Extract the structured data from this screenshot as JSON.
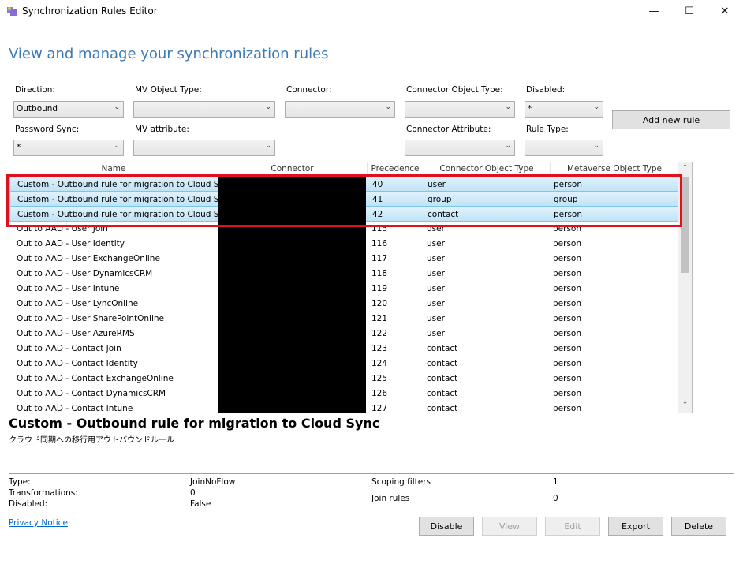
{
  "window": {
    "title": "Synchronization Rules Editor",
    "minimize": "—",
    "maximize": "☐",
    "close": "✕"
  },
  "heading": "View and manage your synchronization rules",
  "filters": {
    "direction": {
      "label": "Direction:",
      "value": "Outbound"
    },
    "mv_object_type": {
      "label": "MV Object Type:",
      "value": ""
    },
    "connector": {
      "label": "Connector:",
      "value": ""
    },
    "connector_object_type": {
      "label": "Connector Object Type:",
      "value": ""
    },
    "disabled": {
      "label": "Disabled:",
      "value": "*"
    },
    "password_sync": {
      "label": "Password Sync:",
      "value": "*"
    },
    "mv_attribute": {
      "label": "MV attribute:",
      "value": ""
    },
    "connector_attribute": {
      "label": "Connector Attribute:",
      "value": ""
    },
    "rule_type": {
      "label": "Rule Type:",
      "value": ""
    }
  },
  "add_rule_label": "Add new rule",
  "columns": [
    "Name",
    "Connector",
    "Precedence",
    "Connector Object Type",
    "Metaverse Object Type"
  ],
  "rows": [
    {
      "name": "Custom - Outbound rule for migration to Cloud Sync",
      "precedence": "40",
      "cot": "user",
      "mot": "person",
      "selected": true
    },
    {
      "name": "Custom - Outbound rule for migration to Cloud Sync",
      "precedence": "41",
      "cot": "group",
      "mot": "group",
      "selected": true
    },
    {
      "name": "Custom - Outbound rule for migration to Cloud Sync",
      "precedence": "42",
      "cot": "contact",
      "mot": "person",
      "selected": true
    },
    {
      "name": "Out to AAD - User Join",
      "precedence": "115",
      "cot": "user",
      "mot": "person",
      "selected": false
    },
    {
      "name": "Out to AAD - User Identity",
      "precedence": "116",
      "cot": "user",
      "mot": "person",
      "selected": false
    },
    {
      "name": "Out to AAD - User ExchangeOnline",
      "precedence": "117",
      "cot": "user",
      "mot": "person",
      "selected": false
    },
    {
      "name": "Out to AAD - User DynamicsCRM",
      "precedence": "118",
      "cot": "user",
      "mot": "person",
      "selected": false
    },
    {
      "name": "Out to AAD - User Intune",
      "precedence": "119",
      "cot": "user",
      "mot": "person",
      "selected": false
    },
    {
      "name": "Out to AAD - User LyncOnline",
      "precedence": "120",
      "cot": "user",
      "mot": "person",
      "selected": false
    },
    {
      "name": "Out to AAD - User SharePointOnline",
      "precedence": "121",
      "cot": "user",
      "mot": "person",
      "selected": false
    },
    {
      "name": "Out to AAD - User AzureRMS",
      "precedence": "122",
      "cot": "user",
      "mot": "person",
      "selected": false
    },
    {
      "name": "Out to AAD - Contact Join",
      "precedence": "123",
      "cot": "contact",
      "mot": "person",
      "selected": false
    },
    {
      "name": "Out to AAD - Contact Identity",
      "precedence": "124",
      "cot": "contact",
      "mot": "person",
      "selected": false
    },
    {
      "name": "Out to AAD - Contact ExchangeOnline",
      "precedence": "125",
      "cot": "contact",
      "mot": "person",
      "selected": false
    },
    {
      "name": "Out to AAD - Contact DynamicsCRM",
      "precedence": "126",
      "cot": "contact",
      "mot": "person",
      "selected": false
    },
    {
      "name": "Out to AAD - Contact Intune",
      "precedence": "127",
      "cot": "contact",
      "mot": "person",
      "selected": false
    }
  ],
  "detail": {
    "title": "Custom - Outbound rule for migration to Cloud Sync",
    "description": "クラウド同期への移行用アウトバウンドルール",
    "type_label": "Type:",
    "type_value": "JoinNoFlow",
    "transformations_label": "Transformations:",
    "transformations_value": "0",
    "disabled_label": "Disabled:",
    "disabled_value": "False",
    "scoping_label": "Scoping filters",
    "scoping_value": "1",
    "join_label": "Join rules",
    "join_value": "0"
  },
  "privacy_notice": "Privacy Notice",
  "buttons": {
    "disable": "Disable",
    "view": "View",
    "edit": "Edit",
    "export": "Export",
    "delete": "Delete"
  },
  "colors": {
    "heading": "#3c7ab8",
    "selection": "#bfe4f7",
    "highlight_border": "#e0101c"
  }
}
